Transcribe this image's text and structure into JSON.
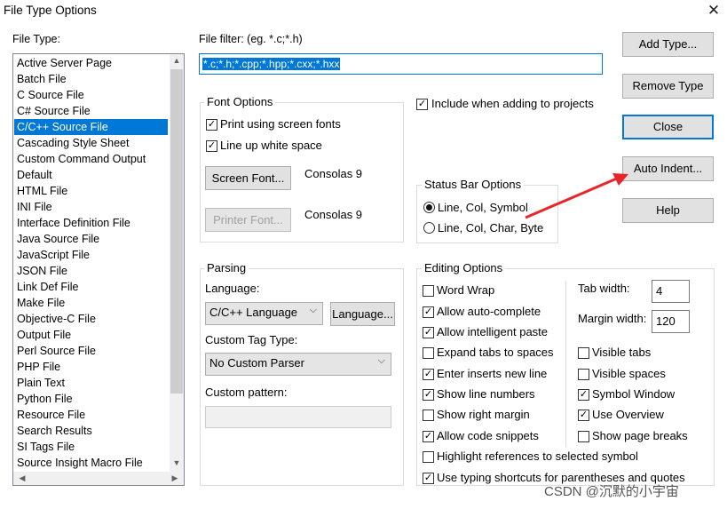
{
  "window": {
    "title": "File Type Options",
    "close_glyph": "✕"
  },
  "file_type": {
    "label": "File Type:",
    "items": [
      "Active Server Page",
      "Batch File",
      "C Source File",
      "C# Source File",
      "C/C++ Source File",
      "Cascading Style Sheet",
      "Custom Command Output",
      "Default",
      "HTML File",
      "INI File",
      "Interface Definition File",
      "Java Source File",
      "JavaScript File",
      "JSON File",
      "Link Def File",
      "Make File",
      "Objective-C File",
      "Output File",
      "Perl Source File",
      "PHP File",
      "Plain Text",
      "Python File",
      "Resource File",
      "Search Results",
      "SI Tags File",
      "Source Insight Macro File"
    ],
    "selected_index": 4
  },
  "file_filter": {
    "label": "File filter: (eg. *.c;*.h)",
    "value": "*.c;*.h;*.cpp;*.hpp;*.cxx;*.hxx"
  },
  "include_projects": {
    "label": "Include when adding to projects",
    "checked": true
  },
  "font_options": {
    "title": "Font Options",
    "print_screen_fonts": {
      "label": "Print using screen fonts",
      "checked": true
    },
    "line_up_white_space": {
      "label": "Line up white space",
      "checked": true
    },
    "screen_font_button": "Screen Font...",
    "screen_font_value": "Consolas 9",
    "printer_font_button": "Printer Font...",
    "printer_font_value": "Consolas 9"
  },
  "status_bar": {
    "title": "Status Bar Options",
    "options": [
      "Line, Col, Symbol",
      "Line, Col, Char, Byte"
    ],
    "selected_index": 0
  },
  "parsing": {
    "title": "Parsing",
    "language_label": "Language:",
    "language_value": "C/C++ Language",
    "language_button": "Language...",
    "custom_tag_label": "Custom Tag Type:",
    "custom_tag_value": "No Custom Parser",
    "custom_pattern_label": "Custom pattern:",
    "custom_pattern_value": ""
  },
  "editing": {
    "title": "Editing Options",
    "left_options": [
      {
        "label": "Word Wrap",
        "checked": false
      },
      {
        "label": "Allow auto-complete",
        "checked": true
      },
      {
        "label": "Allow intelligent paste",
        "checked": true
      },
      {
        "label": "Expand tabs to spaces",
        "checked": false
      },
      {
        "label": "Enter inserts new line",
        "checked": true
      },
      {
        "label": "Show line numbers",
        "checked": true
      },
      {
        "label": "Show right margin",
        "checked": false
      },
      {
        "label": "Allow code snippets",
        "checked": true
      }
    ],
    "tab_width_label": "Tab width:",
    "tab_width_value": "4",
    "margin_width_label": "Margin width:",
    "margin_width_value": "120",
    "right_options": [
      {
        "label": "Visible tabs",
        "checked": false
      },
      {
        "label": "Visible spaces",
        "checked": false
      },
      {
        "label": "Symbol Window",
        "checked": true
      },
      {
        "label": "Use Overview",
        "checked": true
      },
      {
        "label": "Show page breaks",
        "checked": false
      }
    ],
    "full_options": [
      {
        "label": "Highlight references to selected symbol",
        "checked": false
      },
      {
        "label": "Use typing shortcuts for parentheses and quotes",
        "checked": true
      }
    ]
  },
  "buttons": {
    "add_type": "Add Type...",
    "remove_type": "Remove Type",
    "close": "Close",
    "auto_indent": "Auto Indent...",
    "help": "Help"
  },
  "annotation": {
    "arrow_color": "#e8262a"
  },
  "watermark": "CSDN @沉默的小宇宙"
}
